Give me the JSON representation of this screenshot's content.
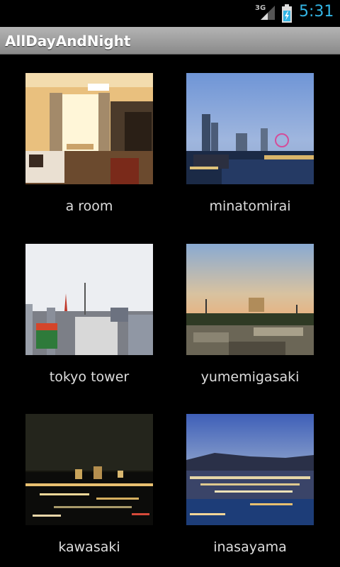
{
  "status_bar": {
    "network": "3G",
    "time": "5:31",
    "signal_icon": "signal-icon",
    "battery_icon": "battery-charging-icon"
  },
  "app_bar": {
    "title": "AllDayAndNight"
  },
  "gallery": {
    "items": [
      {
        "label": "a room",
        "image": "room-photo"
      },
      {
        "label": "minatomirai",
        "image": "harbor-city-dusk-photo"
      },
      {
        "label": "tokyo tower",
        "image": "city-skyline-tower-photo"
      },
      {
        "label": "yumemigasaki",
        "image": "sunset-town-photo"
      },
      {
        "label": "kawasaki",
        "image": "night-city-photo"
      },
      {
        "label": "inasayama",
        "image": "night-panorama-bay-photo"
      }
    ]
  },
  "colors": {
    "accent": "#33b5e5",
    "background": "#000000",
    "title_bar": "#a0a0a0"
  }
}
